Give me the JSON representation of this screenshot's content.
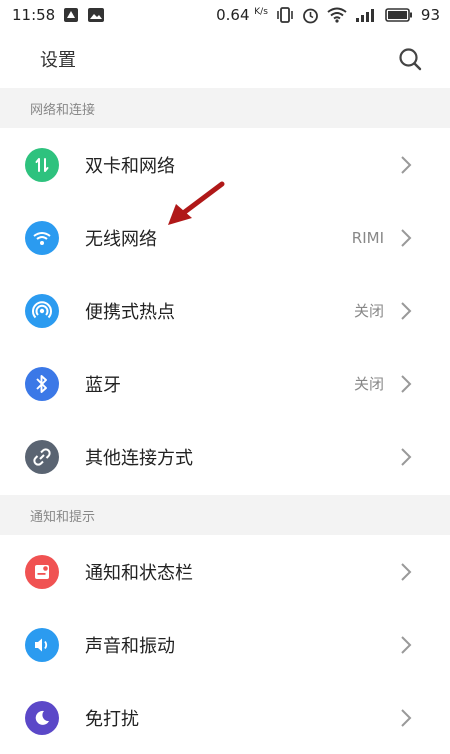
{
  "status_bar": {
    "time": "11:58",
    "net_speed": "0.64",
    "net_unit": "K/s",
    "battery": "93"
  },
  "app_bar": {
    "title": "设置"
  },
  "sections": [
    {
      "header": "网络和连接",
      "items": [
        {
          "label": "双卡和网络",
          "value": "",
          "icon": "dual-sim-icon",
          "color": "#2ec27e"
        },
        {
          "label": "无线网络",
          "value": "RIMI",
          "icon": "wifi-icon",
          "color": "#2b9bf0"
        },
        {
          "label": "便携式热点",
          "value": "关闭",
          "icon": "hotspot-icon",
          "color": "#2b9bf0"
        },
        {
          "label": "蓝牙",
          "value": "关闭",
          "icon": "bluetooth-icon",
          "color": "#3b78e7"
        },
        {
          "label": "其他连接方式",
          "value": "",
          "icon": "link-icon",
          "color": "#5a6472"
        }
      ]
    },
    {
      "header": "通知和提示",
      "items": [
        {
          "label": "通知和状态栏",
          "value": "",
          "icon": "notification-icon",
          "color": "#f05252"
        },
        {
          "label": "声音和振动",
          "value": "",
          "icon": "sound-icon",
          "color": "#2b9bf0"
        },
        {
          "label": "免打扰",
          "value": "",
          "icon": "do-not-disturb-icon",
          "color": "#5b48c8"
        }
      ]
    }
  ],
  "colors": {
    "section_bg": "#f3f3f3",
    "annotation_arrow": "#b01818"
  }
}
